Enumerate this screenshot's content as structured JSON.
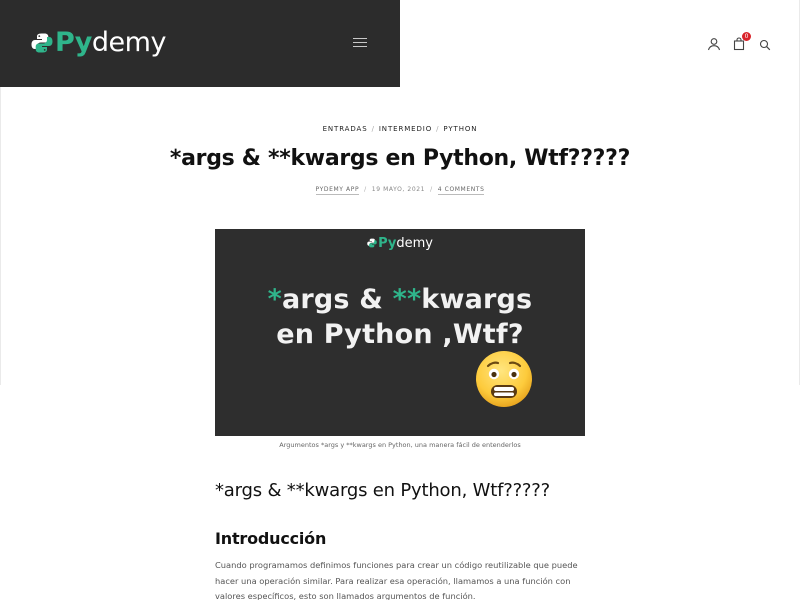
{
  "header": {
    "logo_py": "Py",
    "logo_demy": "demy",
    "cart_count": "0",
    "icons": [
      "menu-icon",
      "user-icon",
      "bag-icon",
      "search-icon"
    ],
    "brand_color": "#2fb58b",
    "bar_color": "#2c2c2c"
  },
  "post": {
    "categories": [
      "ENTRADAS",
      "INTERMEDIO",
      "PYTHON"
    ],
    "category_sep": "/",
    "title": "*args & **kwargs en Python, Wtf?????",
    "author": "PYDEMY APP",
    "date": "19 MAYO, 2021",
    "comments": "4 COMMENTS",
    "byline_sep": "/"
  },
  "featured": {
    "logo_py": "Py",
    "logo_demy": "demy",
    "star1": "*",
    "word1": "args & ",
    "star2": "**",
    "word2": "kwargs",
    "line2": "en Python ,Wtf?",
    "caption": "Argumentos *args y **kwargs en Python, una manera fácil de entenderlos"
  },
  "content": {
    "heading": "*args & **kwargs en Python, Wtf?????",
    "subheading": "Introducción",
    "paragraph": "Cuando programamos definimos funciones para crear un código reutilizable que puede hacer una operación similar. Para realizar esa operación, llamamos a una función con valores específicos, esto son llamados argumentos de función."
  }
}
